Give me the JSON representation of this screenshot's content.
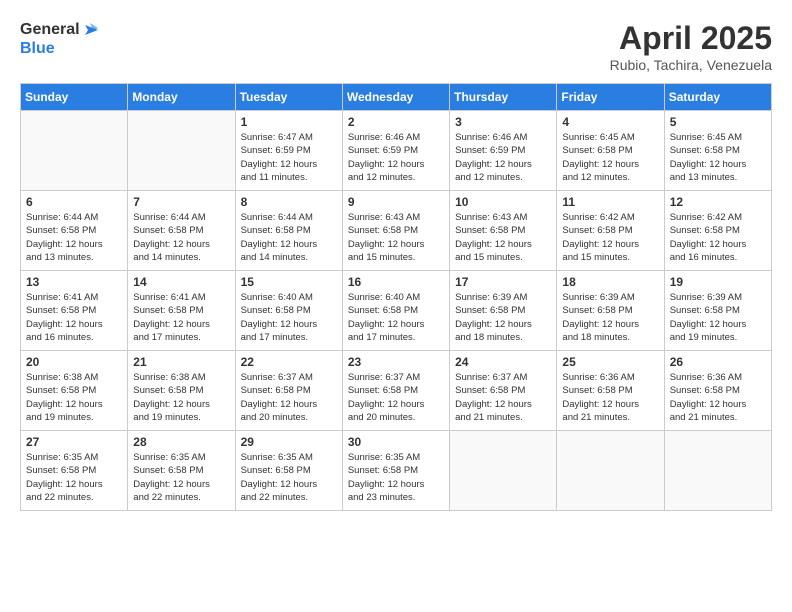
{
  "header": {
    "logo_general": "General",
    "logo_blue": "Blue",
    "month_title": "April 2025",
    "subtitle": "Rubio, Tachira, Venezuela"
  },
  "days_of_week": [
    "Sunday",
    "Monday",
    "Tuesday",
    "Wednesday",
    "Thursday",
    "Friday",
    "Saturday"
  ],
  "weeks": [
    [
      {
        "day": "",
        "info": ""
      },
      {
        "day": "",
        "info": ""
      },
      {
        "day": "1",
        "sunrise": "6:47 AM",
        "sunset": "6:59 PM",
        "daylight": "12 hours and 11 minutes."
      },
      {
        "day": "2",
        "sunrise": "6:46 AM",
        "sunset": "6:59 PM",
        "daylight": "12 hours and 12 minutes."
      },
      {
        "day": "3",
        "sunrise": "6:46 AM",
        "sunset": "6:59 PM",
        "daylight": "12 hours and 12 minutes."
      },
      {
        "day": "4",
        "sunrise": "6:45 AM",
        "sunset": "6:58 PM",
        "daylight": "12 hours and 12 minutes."
      },
      {
        "day": "5",
        "sunrise": "6:45 AM",
        "sunset": "6:58 PM",
        "daylight": "12 hours and 13 minutes."
      }
    ],
    [
      {
        "day": "6",
        "sunrise": "6:44 AM",
        "sunset": "6:58 PM",
        "daylight": "12 hours and 13 minutes."
      },
      {
        "day": "7",
        "sunrise": "6:44 AM",
        "sunset": "6:58 PM",
        "daylight": "12 hours and 14 minutes."
      },
      {
        "day": "8",
        "sunrise": "6:44 AM",
        "sunset": "6:58 PM",
        "daylight": "12 hours and 14 minutes."
      },
      {
        "day": "9",
        "sunrise": "6:43 AM",
        "sunset": "6:58 PM",
        "daylight": "12 hours and 15 minutes."
      },
      {
        "day": "10",
        "sunrise": "6:43 AM",
        "sunset": "6:58 PM",
        "daylight": "12 hours and 15 minutes."
      },
      {
        "day": "11",
        "sunrise": "6:42 AM",
        "sunset": "6:58 PM",
        "daylight": "12 hours and 15 minutes."
      },
      {
        "day": "12",
        "sunrise": "6:42 AM",
        "sunset": "6:58 PM",
        "daylight": "12 hours and 16 minutes."
      }
    ],
    [
      {
        "day": "13",
        "sunrise": "6:41 AM",
        "sunset": "6:58 PM",
        "daylight": "12 hours and 16 minutes."
      },
      {
        "day": "14",
        "sunrise": "6:41 AM",
        "sunset": "6:58 PM",
        "daylight": "12 hours and 17 minutes."
      },
      {
        "day": "15",
        "sunrise": "6:40 AM",
        "sunset": "6:58 PM",
        "daylight": "12 hours and 17 minutes."
      },
      {
        "day": "16",
        "sunrise": "6:40 AM",
        "sunset": "6:58 PM",
        "daylight": "12 hours and 17 minutes."
      },
      {
        "day": "17",
        "sunrise": "6:39 AM",
        "sunset": "6:58 PM",
        "daylight": "12 hours and 18 minutes."
      },
      {
        "day": "18",
        "sunrise": "6:39 AM",
        "sunset": "6:58 PM",
        "daylight": "12 hours and 18 minutes."
      },
      {
        "day": "19",
        "sunrise": "6:39 AM",
        "sunset": "6:58 PM",
        "daylight": "12 hours and 19 minutes."
      }
    ],
    [
      {
        "day": "20",
        "sunrise": "6:38 AM",
        "sunset": "6:58 PM",
        "daylight": "12 hours and 19 minutes."
      },
      {
        "day": "21",
        "sunrise": "6:38 AM",
        "sunset": "6:58 PM",
        "daylight": "12 hours and 19 minutes."
      },
      {
        "day": "22",
        "sunrise": "6:37 AM",
        "sunset": "6:58 PM",
        "daylight": "12 hours and 20 minutes."
      },
      {
        "day": "23",
        "sunrise": "6:37 AM",
        "sunset": "6:58 PM",
        "daylight": "12 hours and 20 minutes."
      },
      {
        "day": "24",
        "sunrise": "6:37 AM",
        "sunset": "6:58 PM",
        "daylight": "12 hours and 21 minutes."
      },
      {
        "day": "25",
        "sunrise": "6:36 AM",
        "sunset": "6:58 PM",
        "daylight": "12 hours and 21 minutes."
      },
      {
        "day": "26",
        "sunrise": "6:36 AM",
        "sunset": "6:58 PM",
        "daylight": "12 hours and 21 minutes."
      }
    ],
    [
      {
        "day": "27",
        "sunrise": "6:35 AM",
        "sunset": "6:58 PM",
        "daylight": "12 hours and 22 minutes."
      },
      {
        "day": "28",
        "sunrise": "6:35 AM",
        "sunset": "6:58 PM",
        "daylight": "12 hours and 22 minutes."
      },
      {
        "day": "29",
        "sunrise": "6:35 AM",
        "sunset": "6:58 PM",
        "daylight": "12 hours and 22 minutes."
      },
      {
        "day": "30",
        "sunrise": "6:35 AM",
        "sunset": "6:58 PM",
        "daylight": "12 hours and 23 minutes."
      },
      {
        "day": "",
        "info": ""
      },
      {
        "day": "",
        "info": ""
      },
      {
        "day": "",
        "info": ""
      }
    ]
  ],
  "labels": {
    "sunrise_label": "Sunrise:",
    "sunset_label": "Sunset:",
    "daylight_label": "Daylight:"
  }
}
